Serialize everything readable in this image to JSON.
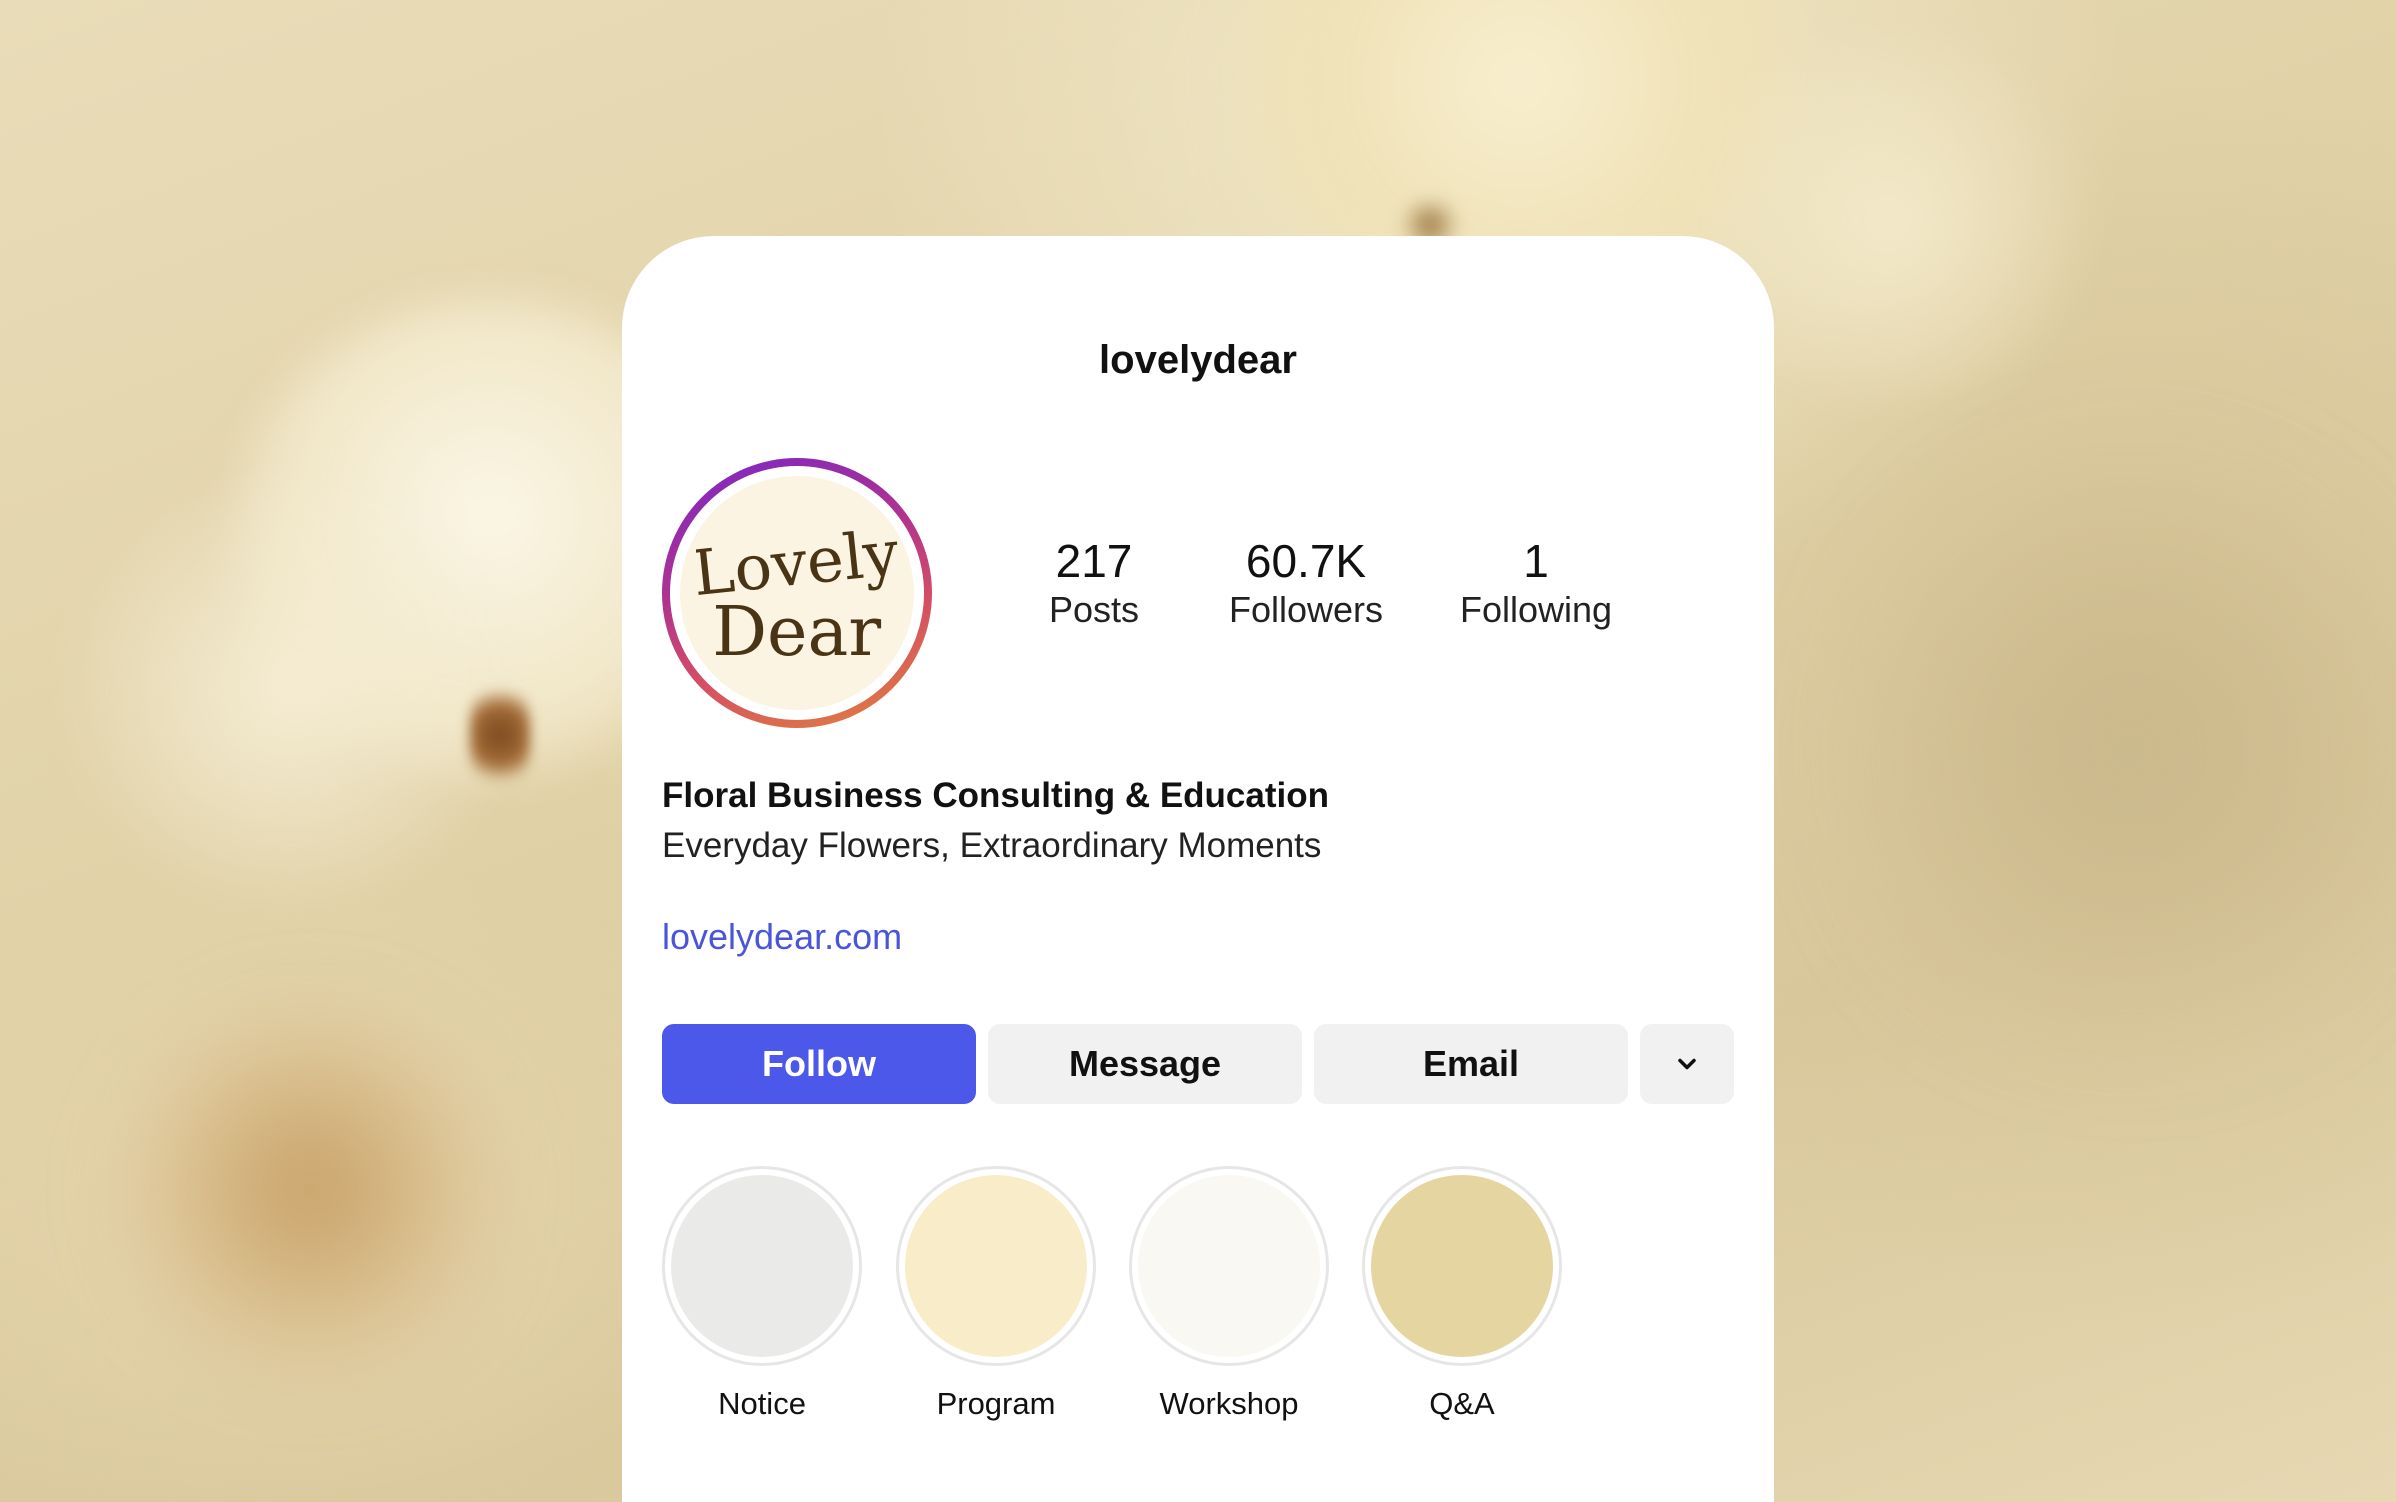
{
  "profile": {
    "username": "lovelydear",
    "avatar_text": [
      "Lovely",
      "Dear"
    ],
    "stats": {
      "posts": {
        "value": "217",
        "label": "Posts"
      },
      "followers": {
        "value": "60.7K",
        "label": "Followers"
      },
      "following": {
        "value": "1",
        "label": "Following"
      }
    },
    "bio": {
      "title": "Floral Business Consulting & Education",
      "tagline": "Everyday Flowers, Extraordinary Moments",
      "link": "lovelydear.com"
    }
  },
  "actions": {
    "follow_label": "Follow",
    "message_label": "Message",
    "email_label": "Email",
    "more_icon": "chevron-down-icon"
  },
  "highlights": [
    {
      "label": "Notice",
      "color": "#eaebe9"
    },
    {
      "label": "Program",
      "color": "#f8edc8"
    },
    {
      "label": "Workshop",
      "color": "#f9f8f2"
    },
    {
      "label": "Q&A",
      "color": "#e4d5a1"
    }
  ],
  "colors": {
    "accent": "#4b58ea",
    "link": "#4a56d8",
    "ring_gradient": [
      "#7a25c8",
      "#d44f64",
      "#e0843c"
    ],
    "avatar_text": "#4a3416"
  }
}
